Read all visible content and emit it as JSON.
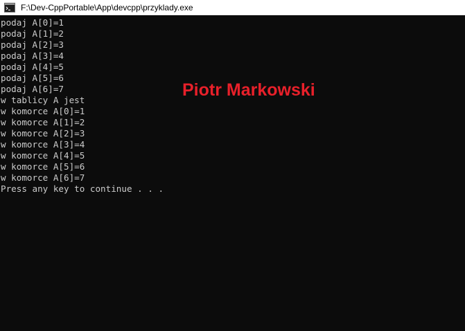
{
  "window": {
    "title": "F:\\Dev-CppPortable\\App\\devcpp\\przyklady.exe",
    "icon": "console-app-icon"
  },
  "console": {
    "lines": [
      "podaj A[0]=1",
      "podaj A[1]=2",
      "podaj A[2]=3",
      "podaj A[3]=4",
      "podaj A[4]=5",
      "podaj A[5]=6",
      "podaj A[6]=7",
      "w tablicy A jest",
      "w komorce A[0]=1",
      "w komorce A[1]=2",
      "w komorce A[2]=3",
      "w komorce A[3]=4",
      "w komorce A[4]=5",
      "w komorce A[5]=6",
      "w komorce A[6]=7",
      "Press any key to continue . . ."
    ]
  },
  "overlay": {
    "author_text": "Piotr Markowski",
    "color": "#e8202a"
  },
  "colors": {
    "console_background": "#0c0c0c",
    "console_text": "#cccccc",
    "titlebar_background": "#ffffff"
  }
}
